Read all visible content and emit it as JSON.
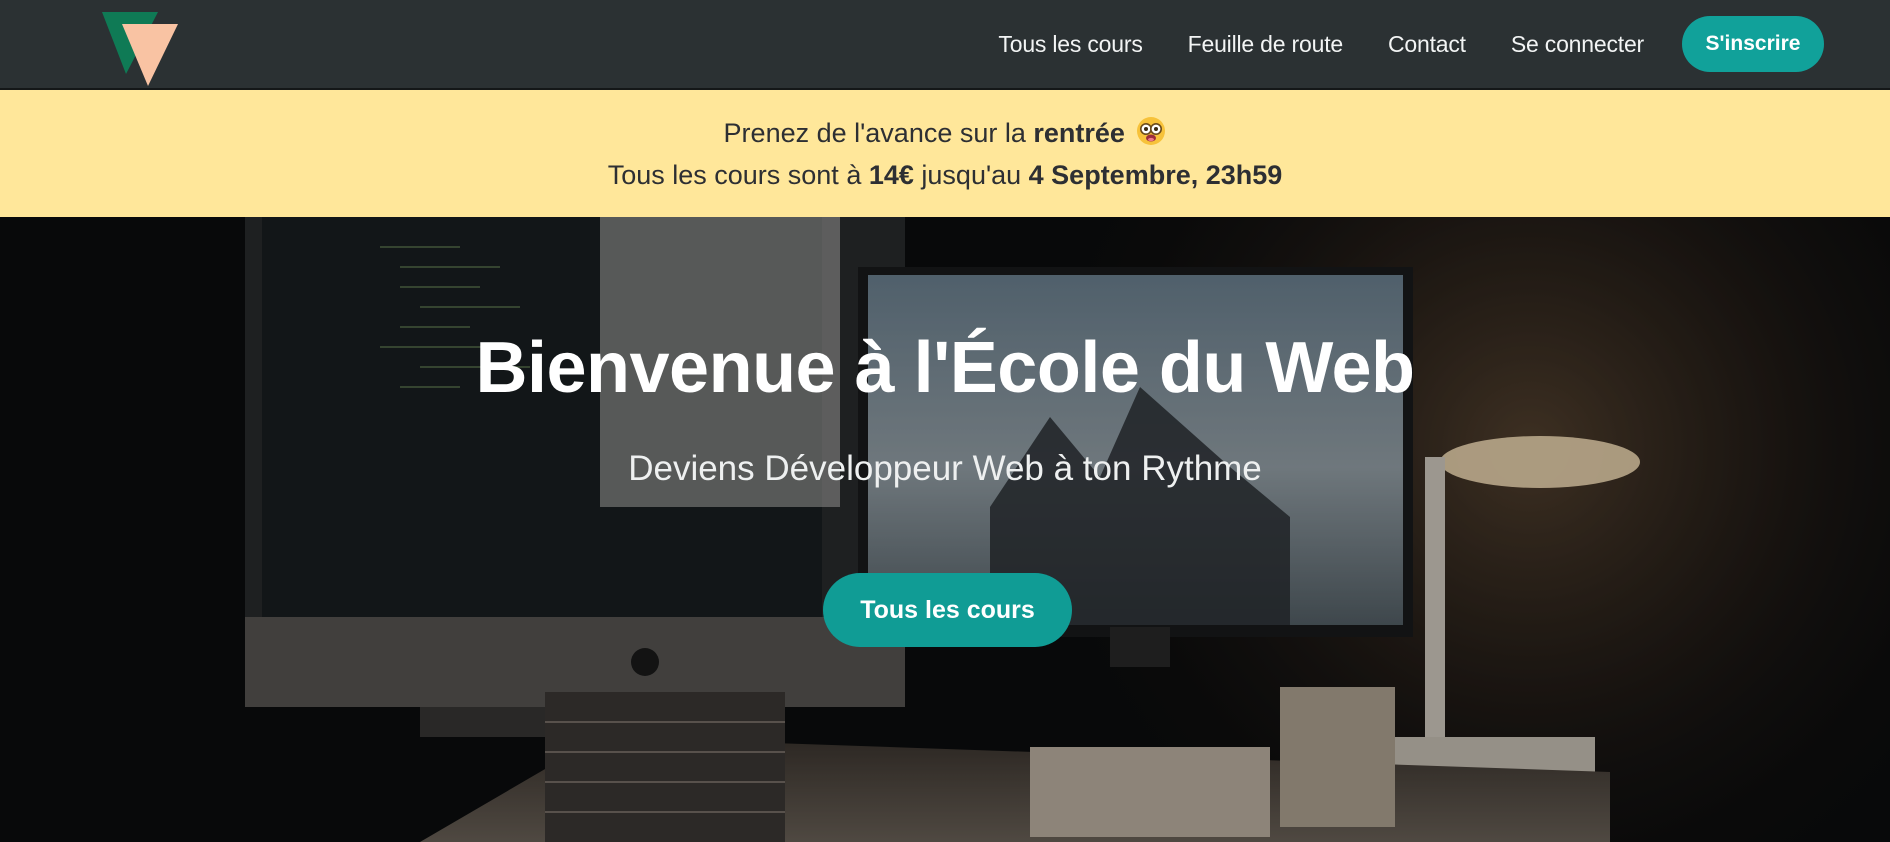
{
  "nav": {
    "logo_icon": "triangle-logo-icon",
    "links": [
      "Tous les cours",
      "Feuille de route",
      "Contact",
      "Se connecter"
    ],
    "signup_label": "S'inscrire"
  },
  "promo": {
    "line1_prefix": "Prenez de l'avance sur la ",
    "line1_bold": "rentrée",
    "line1_emoji": "nerd-face-icon",
    "line2_prefix": "Tous les cours sont à ",
    "line2_price": "14€",
    "line2_middle": " jusqu'au ",
    "line2_date": "4 Septembre, 23h59"
  },
  "hero": {
    "title": "Bienvenue à l'École du Web",
    "subtitle": "Deviens Développeur Web à ton Rythme",
    "cta_label": "Tous les cours"
  },
  "colors": {
    "navbar_bg": "#2b3133",
    "accent": "#11a19a",
    "promo_bg": "#ffe79a",
    "logo_green": "#0f7a55",
    "logo_peach": "#f9c3a3"
  }
}
